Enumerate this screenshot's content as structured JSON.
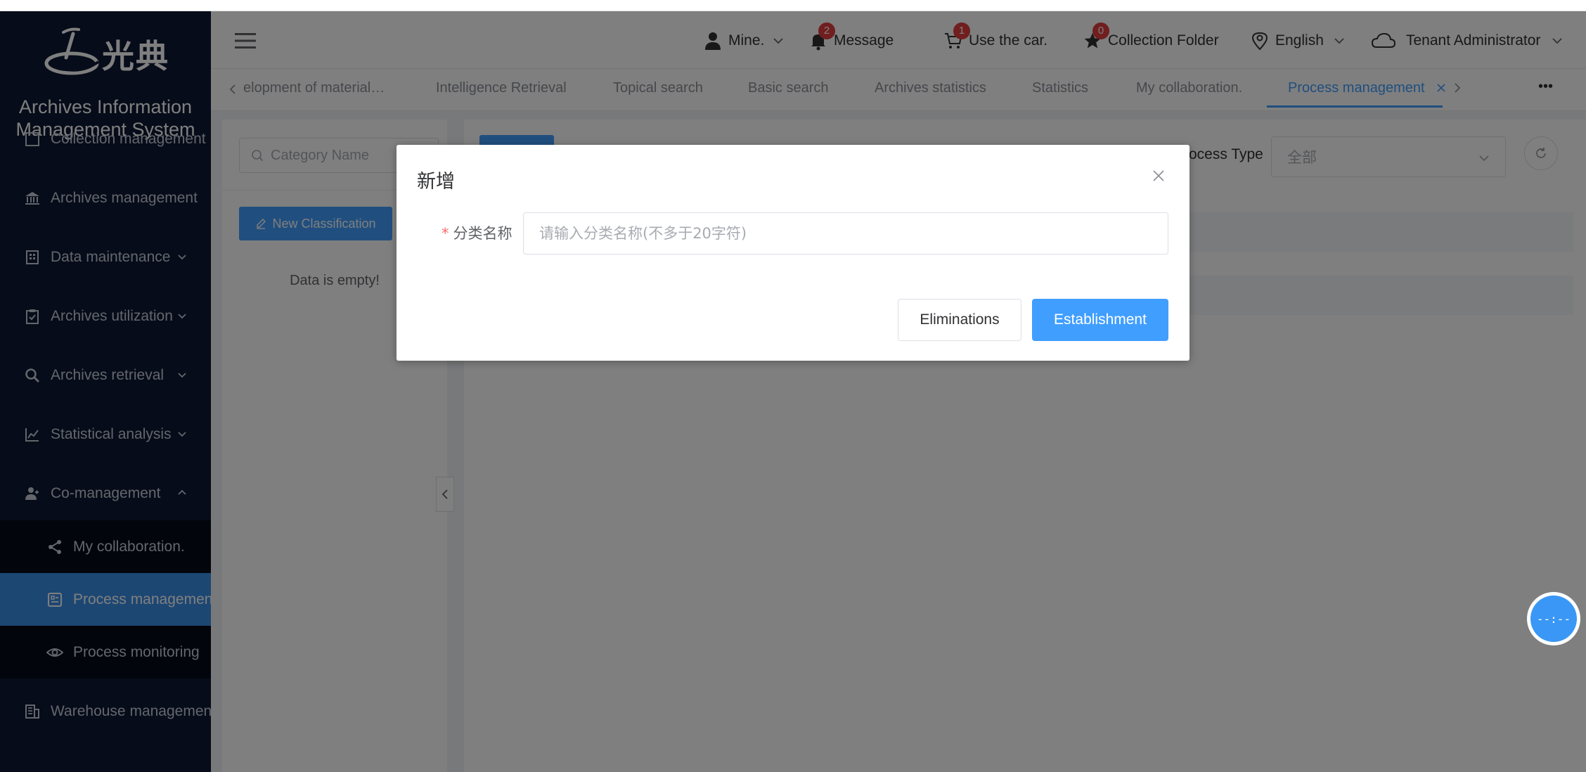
{
  "app": {
    "logo_text": "光典",
    "system_title_line1": "Archives Information",
    "system_title_line2": "Management System"
  },
  "sidebar": {
    "items": [
      {
        "label": "Collection management",
        "icon": "collection-icon"
      },
      {
        "label": "Archives management",
        "icon": "bank-icon"
      },
      {
        "label": "Data maintenance",
        "icon": "building-icon"
      },
      {
        "label": "Archives utilization",
        "icon": "clipboard-check-icon"
      },
      {
        "label": "Archives retrieval",
        "icon": "search-icon"
      },
      {
        "label": "Statistical analysis",
        "icon": "chart-icon"
      },
      {
        "label": "Co-management",
        "icon": "users-icon"
      },
      {
        "label": "Warehouse management",
        "icon": "warehouse-icon"
      }
    ],
    "subitems": [
      {
        "label": "My collaboration.",
        "icon": "share-icon"
      },
      {
        "label": "Process management",
        "icon": "process-icon",
        "active": true
      },
      {
        "label": "Process monitoring",
        "icon": "eye-icon"
      }
    ]
  },
  "header": {
    "mine": "Mine.",
    "message": "Message",
    "message_count": "2",
    "cart": "Use the car.",
    "cart_count": "1",
    "collection": "Collection Folder",
    "collection_count": "0",
    "language": "English",
    "user": "Tenant Administrator"
  },
  "tabs": [
    "elopment of material…",
    "Intelligence Retrieval",
    "Topical search",
    "Basic search",
    "Archives statistics",
    "Statistics",
    "My collaboration.",
    "Process management"
  ],
  "tab_more": "•••",
  "left_panel": {
    "search_placeholder": "Category Name",
    "new_button": "New Classification",
    "empty_text": "Data is empty!"
  },
  "right_panel": {
    "process_type_label": "Process Type",
    "process_type_value": "全部"
  },
  "dialog": {
    "title": "新增",
    "required_mark": "*",
    "field_label": "分类名称",
    "field_placeholder": "请输入分类名称(不多于20字符)",
    "field_value": "",
    "cancel_label": "Eliminations",
    "confirm_label": "Establishment"
  },
  "float_widget": {
    "text": "--:--"
  },
  "colors": {
    "sidebar_bg": "#0c1833",
    "accent": "#409eff",
    "badge": "#e03c3c"
  }
}
